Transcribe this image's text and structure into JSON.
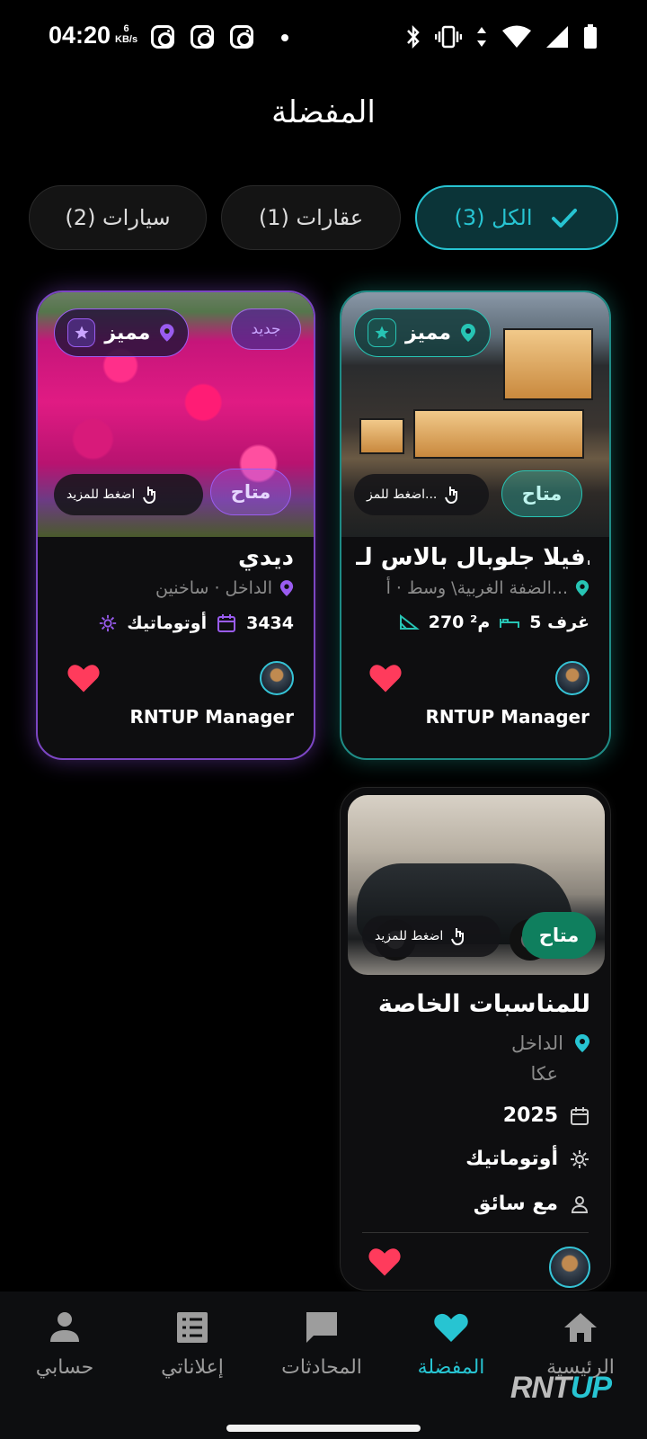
{
  "status_bar": {
    "time": "04:20",
    "speed_value": "6",
    "speed_unit": "KB/s"
  },
  "header": {
    "title": "المفضلة"
  },
  "filters": [
    {
      "label": "الكل (3)",
      "selected": true
    },
    {
      "label": "عقارات (1)",
      "selected": false
    },
    {
      "label": "سيارات (2)",
      "selected": false
    }
  ],
  "cards": {
    "villa": {
      "feature_label": "مميز",
      "more_label": "اضغط للمز...",
      "status_label": "متاح",
      "title": "فيلا جلوبال بالاس لـ...",
      "location": "الضفة الغربية\\ وسط · أ...",
      "rooms": "5 غرف",
      "area": "270 م²",
      "owner": "RNTUP Manager",
      "accent": "#27c4b4"
    },
    "didi": {
      "feature_label": "مميز",
      "new_label": "جديد",
      "more_label": "اضغط للمزيد",
      "status_label": "متاح",
      "title": "ديدي",
      "location": "الداخل · ساخنين",
      "year": "3434",
      "transmission": "أوتوماتيك",
      "owner": "RNTUP Manager",
      "accent": "#9a5cf0"
    },
    "car": {
      "more_label": "اضغط للمزيد",
      "status_label": "متاح",
      "title": "للمناسبات الخاصة",
      "region": "الداخل",
      "city": "عكا",
      "year": "2025",
      "transmission": "أوتوماتيك",
      "driver": "مع سائق"
    }
  },
  "bottom_nav": {
    "items": [
      {
        "label": "الرئيسية",
        "icon": "home-icon"
      },
      {
        "label": "المفضلة",
        "icon": "heart-icon",
        "active": true
      },
      {
        "label": "المحادثات",
        "icon": "chat-icon"
      },
      {
        "label": "إعلاناتي",
        "icon": "list-icon"
      },
      {
        "label": "حسابي",
        "icon": "person-icon"
      }
    ],
    "watermark_a": "RNT",
    "watermark_b": "UP"
  },
  "colors": {
    "accent": "#27c4d2",
    "heart": "#ff3b5c",
    "purple": "#9a5cf0",
    "available_green": "#0f7f5e"
  }
}
